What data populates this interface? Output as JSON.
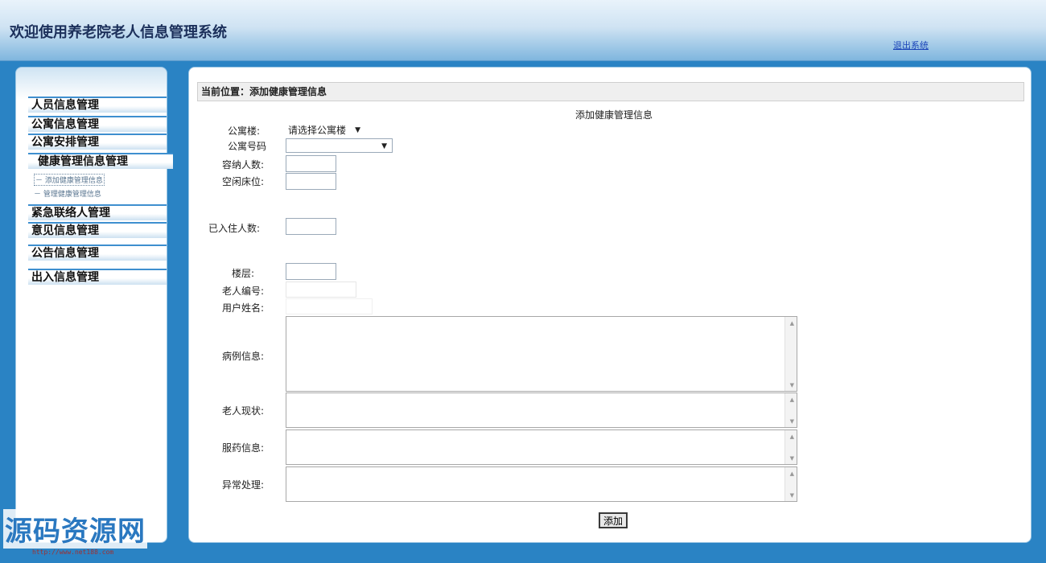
{
  "header": {
    "title": "欢迎使用养老院老人信息管理系统",
    "logout": "退出系统"
  },
  "sidebar": {
    "menus": [
      {
        "label": "人员信息管理"
      },
      {
        "label": "公寓信息管理"
      },
      {
        "label": "公寓安排管理"
      },
      {
        "label": "健康管理信息管理"
      },
      {
        "label": "紧急联络人管理"
      },
      {
        "label": "意见信息管理"
      },
      {
        "label": "公告信息管理"
      },
      {
        "label": "出入信息管理"
      }
    ],
    "submenu": [
      {
        "label": "－ 添加健康管理信息"
      },
      {
        "label": "－ 管理健康管理信息"
      }
    ]
  },
  "watermark": {
    "text": "源码资源网",
    "url": "http://www.net188.com"
  },
  "main": {
    "breadcrumb": "当前位置：添加健康管理信息",
    "form_title": "添加健康管理信息",
    "fields": {
      "building_label": "公寓楼:",
      "building_select": "请选择公寓楼",
      "room_label": "公寓号码",
      "room_select": "",
      "capacity_label": "容纳人数:",
      "free_beds_label": "空闲床位:",
      "occupied_label": "已入住人数:",
      "floor_label": "楼层:",
      "elder_id_label": "老人编号:",
      "username_label": "用户姓名:",
      "case_label": "病例信息:",
      "status_label": "老人现状:",
      "medication_label": "服药信息:",
      "exception_label": "异常处理:"
    },
    "submit": "添加"
  }
}
